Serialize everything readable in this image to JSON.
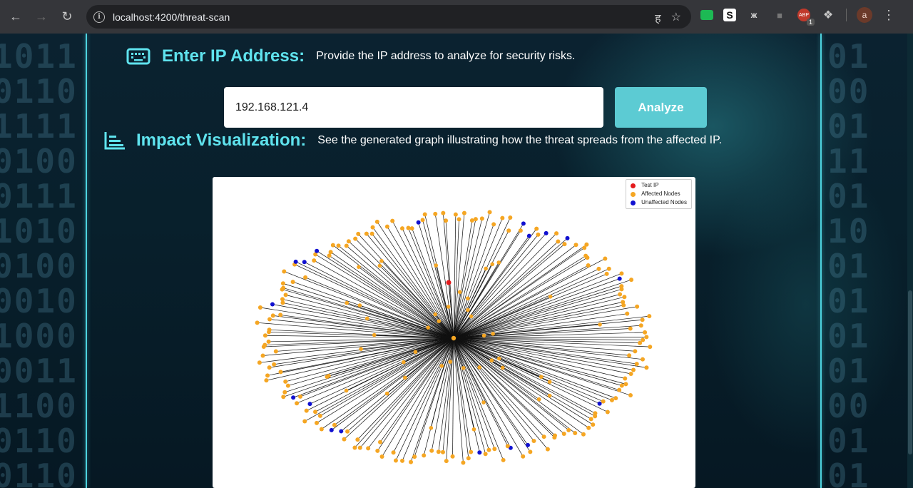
{
  "browser": {
    "url_host": "localhost",
    "url_path": ":4200/threat-scan",
    "abp_badge": "1",
    "avatar_letter": "a"
  },
  "ip_section": {
    "title": "Enter IP Address:",
    "description": "Provide the IP address to analyze for security risks.",
    "input_value": "192.168.121.4",
    "button_label": "Analyze"
  },
  "viz_section": {
    "title": "Impact Visualization:",
    "description": "See the generated graph illustrating how the threat spreads from the affected IP."
  },
  "graph": {
    "legend": [
      {
        "label": "Test IP",
        "color": "#e41a1c"
      },
      {
        "label": "Affected Nodes",
        "color": "#f5a623"
      },
      {
        "label": "Unaffected Nodes",
        "color": "#1010d0"
      }
    ]
  },
  "background": {
    "left_binary": [
      "1011",
      "0110",
      "1111",
      "0100",
      "0111",
      "1010",
      "0100",
      "0010",
      "1000",
      "0011",
      "1100",
      "0110",
      "0110"
    ],
    "right_binary": [
      "01",
      "00",
      "01",
      "11",
      "01",
      "10",
      "01",
      "01",
      "01",
      "01",
      "00",
      "01",
      "01"
    ]
  }
}
